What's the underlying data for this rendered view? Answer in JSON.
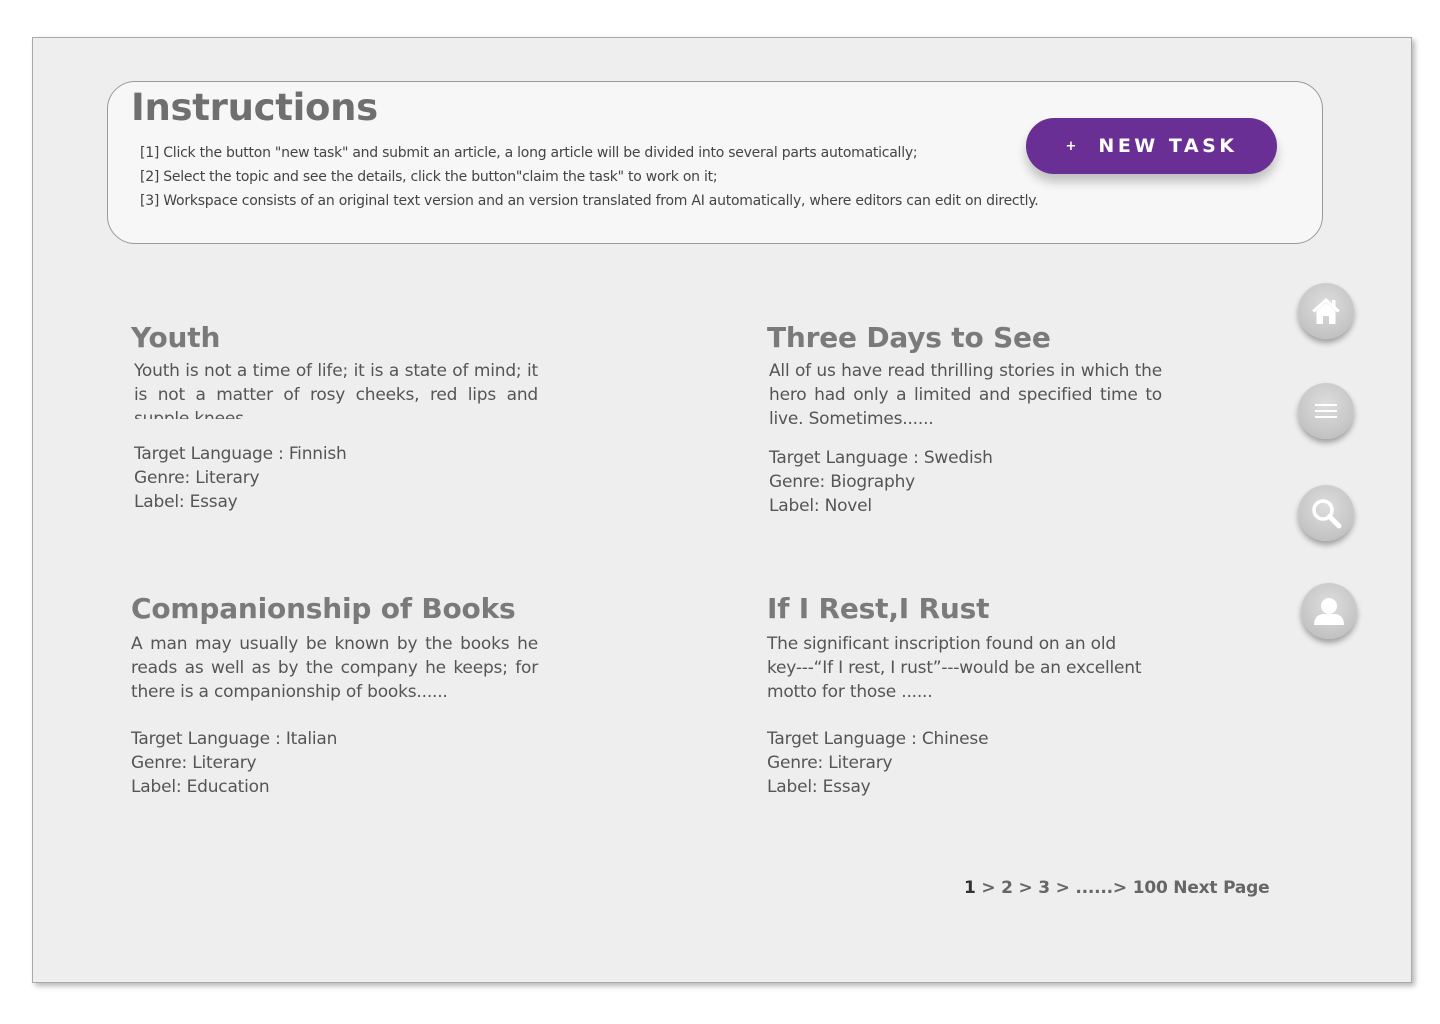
{
  "instructions": {
    "title": "Instructions",
    "items": [
      "[1] Click the button \"new task\" and submit an article, a long article will be divided into several parts automatically;",
      "[2] Select the topic and see the details, click the button\"claim the task\" to work on it;",
      "[3] Workspace consists of an original text version and an version translated from AI automatically, where editors can edit on directly."
    ]
  },
  "new_task_button": {
    "icon": "+",
    "label": "NEW TASK",
    "color": "#6a2f94"
  },
  "articles": [
    {
      "title": "Youth",
      "excerpt": "Youth is not a time of life; it is a state of mind; it is not a matter of rosy cheeks, red lips and supple knees......",
      "target_language": "Target Language : Finnish",
      "genre": "Genre: Literary",
      "label": "Label: Essay"
    },
    {
      "title": "Three Days to See",
      "excerpt": "All of us have read thrilling stories in which the hero had only a limited and specified time to live. Sometimes......",
      "target_language": "Target Language : Swedish",
      "genre": "Genre: Biography",
      "label": "Label: Novel"
    },
    {
      "title": "Companionship of Books",
      "excerpt": "A man may usually be known by the books he reads as well as by the company he keeps; for there is a companionship of books......",
      "target_language": "Target Language : Italian",
      "genre": "Genre: Literary",
      "label": "Label: Education"
    },
    {
      "title": "If I Rest,I Rust",
      "excerpt_lines": [
        "The significant inscription found on an old",
        "key---“If I rest, I rust”---would be an excellent",
        "motto for those ......"
      ],
      "target_language": "Target Language : Chinese",
      "genre": "Genre: Literary",
      "label": "Label: Essay"
    }
  ],
  "side_nav": [
    {
      "name": "home",
      "icon": "home-icon"
    },
    {
      "name": "menu",
      "icon": "menu-icon"
    },
    {
      "name": "search",
      "icon": "search-icon"
    },
    {
      "name": "profile",
      "icon": "user-icon"
    }
  ],
  "pagination": {
    "current": "1",
    "items": [
      " > ",
      "2",
      " > ",
      "3",
      " > ",
      "......> ",
      "100",
      " ",
      "Next Page"
    ]
  }
}
